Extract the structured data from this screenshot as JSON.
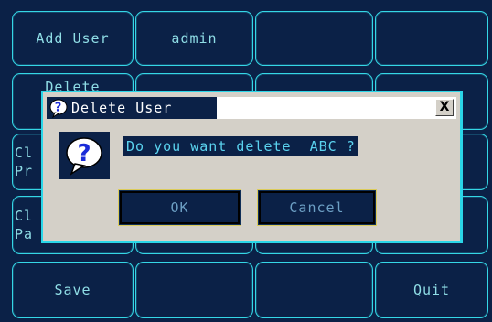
{
  "grid": {
    "add_user": "Add User",
    "admin": "admin",
    "delete": "Delete",
    "r2c1_line1": "Cl",
    "r2c1_line2": "Pr",
    "r3c1_line1": "Cl",
    "r3c1_line2": "Pa",
    "save": "Save",
    "quit": "Quit"
  },
  "dialog": {
    "title": "Delete User",
    "close_label": "X",
    "message": "Do you want delete  ABC ?",
    "ok_label": "OK",
    "cancel_label": "Cancel",
    "icon": "question-icon"
  },
  "colors": {
    "background": "#0b2147",
    "border_cyan": "#35d7e6",
    "dialog_gray": "#d4d0c8",
    "text_cyan": "#8fdde6"
  }
}
